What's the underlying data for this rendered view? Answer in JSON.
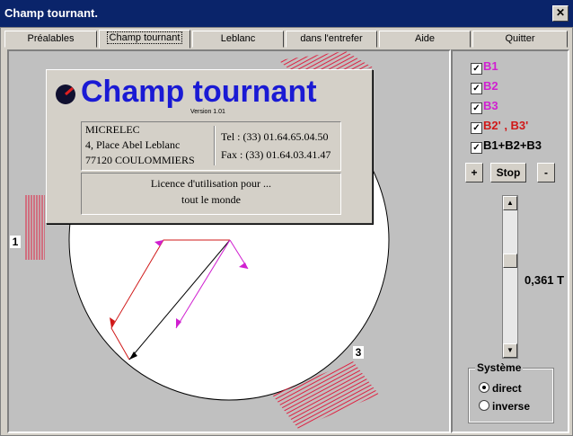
{
  "window": {
    "title": "Champ tournant."
  },
  "tabs": [
    "Préalables",
    "Champ tournant",
    "Leblanc",
    "dans l'entrefer",
    "Aide",
    "Quitter"
  ],
  "checkboxes": [
    {
      "label": "B1",
      "color": "#d020d0"
    },
    {
      "label": "B2",
      "color": "#d020d0"
    },
    {
      "label": "B3",
      "color": "#d020d0"
    },
    {
      "label": "B2' , B3'",
      "color": "#d01818"
    },
    {
      "label": "B1+B2+B3",
      "color": "#000000"
    }
  ],
  "controls": {
    "plus": "+",
    "stop": "Stop",
    "minus": "-",
    "value": "0,361 T"
  },
  "systeme": {
    "legend": "Système",
    "options": [
      "direct",
      "inverse"
    ],
    "selected": "direct"
  },
  "markers": {
    "m1": "1",
    "m3": "3"
  },
  "about": {
    "title": "Champ tournant",
    "version": "Version 1.01",
    "company": "MICRELEC",
    "street": "4, Place Abel Leblanc",
    "city": "77120 COULOMMIERS",
    "tel": "Tel : (33) 01.64.65.04.50",
    "fax": "Fax : (33) 01.64.03.41.47",
    "licence1": "Licence d'utilisation pour ...",
    "licence2": "tout le monde"
  },
  "colors": {
    "magenta": "#d020d0",
    "red": "#d01818",
    "hatch": "#e02040",
    "titlebar": "#0a246a"
  }
}
